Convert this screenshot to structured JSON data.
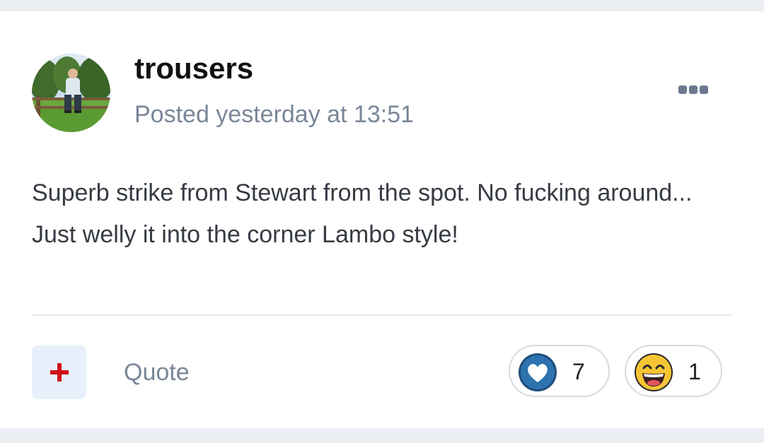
{
  "post": {
    "author": "trousers",
    "timestamp": "Posted yesterday at 13:51",
    "body": "Superb strike from Stewart from the spot. No fucking around... Just welly it into the corner Lambo style!",
    "avatar_icon": "avatar-photo",
    "more_icon": "ellipsis-icon"
  },
  "actions": {
    "add_icon": "plus-icon",
    "add_icon_color": "#d0121b",
    "quote_label": "Quote"
  },
  "reactions": [
    {
      "name": "like",
      "icon": "heart-icon",
      "count": "7",
      "color": "#2d73b0"
    },
    {
      "name": "haha",
      "icon": "laughing-face-icon",
      "count": "1",
      "color": "#f5c534"
    }
  ]
}
